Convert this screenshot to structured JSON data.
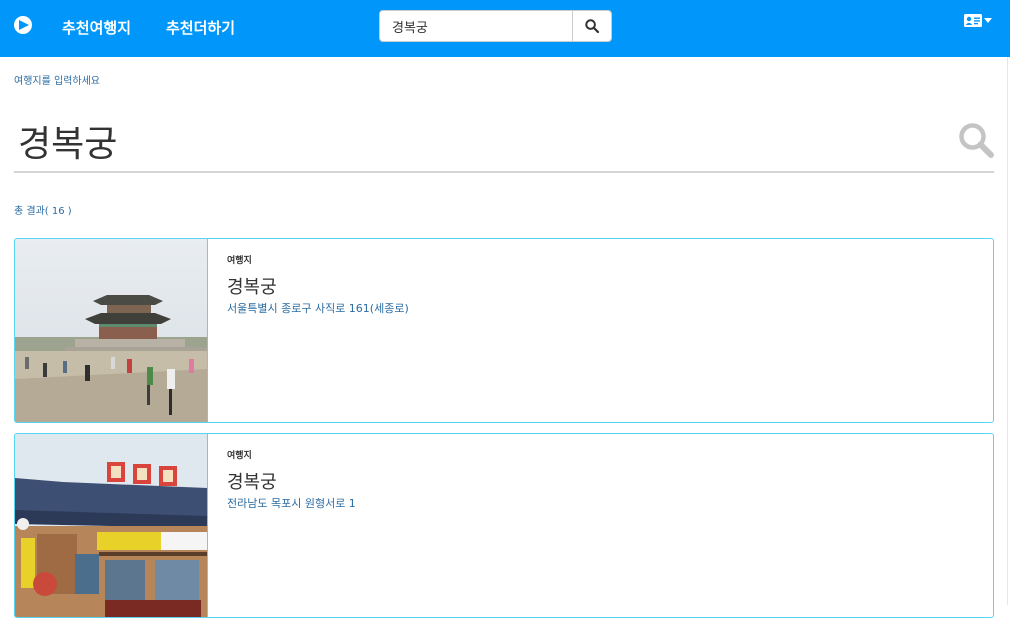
{
  "nav": {
    "logo_icon": "play-circle-icon",
    "links": [
      "추천여행지",
      "추천더하기"
    ],
    "search_value": "경복궁",
    "search_icon": "search-icon",
    "user_icon": "user-card-icon"
  },
  "hint": "여행지를 입력하세요",
  "query": "경복궁",
  "result_count": "총 결과( 16 )",
  "results": [
    {
      "category": "여행지",
      "title": "경복궁",
      "address": "서울특별시 종로구 사직로 161(세종로)"
    },
    {
      "category": "여행지",
      "title": "경복궁",
      "address": "전라남도 목포시 원형서로 1"
    }
  ],
  "colors": {
    "navbar": "#0096fa",
    "accent_text": "#2b6ca3",
    "card_border": "#56d6f2"
  }
}
